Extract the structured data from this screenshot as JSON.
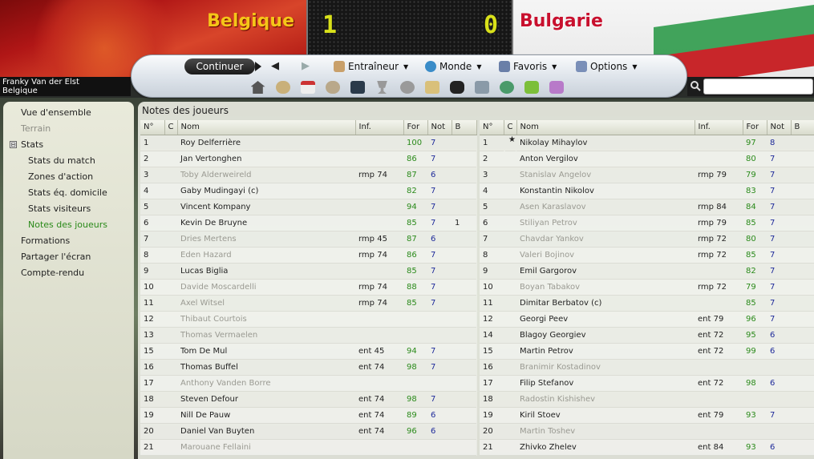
{
  "header": {
    "home_team": "Belgique",
    "away_team": "Bulgarie",
    "home_score": "1",
    "away_score": "0",
    "home_color": "#f5c518",
    "away_color": "#c8102e"
  },
  "toolbar": {
    "continue_label": "Continuer",
    "back_icon": "arrow-left-icon",
    "forward_icon": "arrow-right-icon",
    "menus": [
      {
        "label": "Entraîneur",
        "icon": "manager-icon"
      },
      {
        "label": "Monde",
        "icon": "globe-icon"
      },
      {
        "label": "Favoris",
        "icon": "favorites-icon"
      },
      {
        "label": "Options",
        "icon": "options-icon"
      }
    ],
    "icons": [
      "home-icon",
      "club-icon",
      "calendar-icon",
      "squad-icon",
      "tactics-icon",
      "trophy-icon",
      "scout-icon",
      "clipboard-icon",
      "binoculars-icon",
      "inbox-icon",
      "world-icon",
      "help-icon",
      "question-icon"
    ]
  },
  "manager": {
    "name": "Franky Van der Elst",
    "team": "Belgique"
  },
  "sidebar": {
    "items": [
      {
        "label": "Vue d'ensemble",
        "level": 1,
        "state": "normal"
      },
      {
        "label": "Terrain",
        "level": 1,
        "state": "disabled"
      },
      {
        "label": "Stats",
        "level": 1,
        "state": "normal",
        "toggle": "⊟"
      },
      {
        "label": "Stats du match",
        "level": 2,
        "state": "normal"
      },
      {
        "label": "Zones d'action",
        "level": 2,
        "state": "normal"
      },
      {
        "label": "Stats éq. domicile",
        "level": 2,
        "state": "normal"
      },
      {
        "label": "Stats visiteurs",
        "level": 2,
        "state": "normal"
      },
      {
        "label": "Notes des joueurs",
        "level": 2,
        "state": "active"
      },
      {
        "label": "Formations",
        "level": 1,
        "state": "normal"
      },
      {
        "label": "Partager l'écran",
        "level": 1,
        "state": "normal"
      },
      {
        "label": "Compte-rendu",
        "level": 1,
        "state": "normal"
      }
    ]
  },
  "panel": {
    "title": "Notes des joueurs",
    "columns": [
      "N°",
      "C",
      "Nom",
      "Inf.",
      "For",
      "Not",
      "B"
    ]
  },
  "home_players": [
    {
      "num": "1",
      "c": "",
      "name": "Roy Delferrière",
      "inf": "",
      "for": "100",
      "note": "7",
      "b": "",
      "played": true
    },
    {
      "num": "2",
      "c": "",
      "name": "Jan Vertonghen",
      "inf": "",
      "for": "86",
      "note": "7",
      "b": "",
      "played": true
    },
    {
      "num": "3",
      "c": "",
      "name": "Toby Alderweireld",
      "inf": "rmp 74",
      "for": "87",
      "note": "6",
      "b": "",
      "played": false
    },
    {
      "num": "4",
      "c": "",
      "name": "Gaby Mudingayi (c)",
      "inf": "",
      "for": "82",
      "note": "7",
      "b": "",
      "played": true
    },
    {
      "num": "5",
      "c": "",
      "name": "Vincent Kompany",
      "inf": "",
      "for": "94",
      "note": "7",
      "b": "",
      "played": true
    },
    {
      "num": "6",
      "c": "",
      "name": "Kevin De Bruyne",
      "inf": "",
      "for": "85",
      "note": "7",
      "b": "1",
      "played": true
    },
    {
      "num": "7",
      "c": "",
      "name": "Dries Mertens",
      "inf": "rmp 45",
      "for": "87",
      "note": "6",
      "b": "",
      "played": false
    },
    {
      "num": "8",
      "c": "",
      "name": "Eden Hazard",
      "inf": "rmp 74",
      "for": "86",
      "note": "7",
      "b": "",
      "played": false
    },
    {
      "num": "9",
      "c": "",
      "name": "Lucas Biglia",
      "inf": "",
      "for": "85",
      "note": "7",
      "b": "",
      "played": true
    },
    {
      "num": "10",
      "c": "",
      "name": "Davide Moscardelli",
      "inf": "rmp 74",
      "for": "88",
      "note": "7",
      "b": "",
      "played": false
    },
    {
      "num": "11",
      "c": "",
      "name": "Axel Witsel",
      "inf": "rmp 74",
      "for": "85",
      "note": "7",
      "b": "",
      "played": false
    },
    {
      "num": "12",
      "c": "",
      "name": "Thibaut Courtois",
      "inf": "",
      "for": "",
      "note": "",
      "b": "",
      "played": false
    },
    {
      "num": "13",
      "c": "",
      "name": "Thomas Vermaelen",
      "inf": "",
      "for": "",
      "note": "",
      "b": "",
      "played": false
    },
    {
      "num": "15",
      "c": "",
      "name": "Tom De Mul",
      "inf": "ent 45",
      "for": "94",
      "note": "7",
      "b": "",
      "played": true
    },
    {
      "num": "16",
      "c": "",
      "name": "Thomas Buffel",
      "inf": "ent 74",
      "for": "98",
      "note": "7",
      "b": "",
      "played": true
    },
    {
      "num": "17",
      "c": "",
      "name": "Anthony Vanden Borre",
      "inf": "",
      "for": "",
      "note": "",
      "b": "",
      "played": false
    },
    {
      "num": "18",
      "c": "",
      "name": "Steven Defour",
      "inf": "ent 74",
      "for": "98",
      "note": "7",
      "b": "",
      "played": true
    },
    {
      "num": "19",
      "c": "",
      "name": "Nill De Pauw",
      "inf": "ent 74",
      "for": "89",
      "note": "6",
      "b": "",
      "played": true
    },
    {
      "num": "20",
      "c": "",
      "name": "Daniel Van Buyten",
      "inf": "ent 74",
      "for": "96",
      "note": "6",
      "b": "",
      "played": true
    },
    {
      "num": "21",
      "c": "",
      "name": "Marouane Fellaini",
      "inf": "",
      "for": "",
      "note": "",
      "b": "",
      "played": false
    }
  ],
  "away_players": [
    {
      "num": "1",
      "c": "★",
      "name": "Nikolay Mihaylov",
      "inf": "",
      "for": "97",
      "note": "8",
      "b": "",
      "played": true
    },
    {
      "num": "2",
      "c": "",
      "name": "Anton Vergilov",
      "inf": "",
      "for": "80",
      "note": "7",
      "b": "",
      "played": true
    },
    {
      "num": "3",
      "c": "",
      "name": "Stanislav Angelov",
      "inf": "rmp 79",
      "for": "79",
      "note": "7",
      "b": "",
      "played": false
    },
    {
      "num": "4",
      "c": "",
      "name": "Konstantin Nikolov",
      "inf": "",
      "for": "83",
      "note": "7",
      "b": "",
      "played": true
    },
    {
      "num": "5",
      "c": "",
      "name": "Asen Karaslavov",
      "inf": "rmp 84",
      "for": "84",
      "note": "7",
      "b": "",
      "played": false
    },
    {
      "num": "6",
      "c": "",
      "name": "Stiliyan Petrov",
      "inf": "rmp 79",
      "for": "85",
      "note": "7",
      "b": "",
      "played": false
    },
    {
      "num": "7",
      "c": "",
      "name": "Chavdar Yankov",
      "inf": "rmp 72",
      "for": "80",
      "note": "7",
      "b": "",
      "played": false
    },
    {
      "num": "8",
      "c": "",
      "name": "Valeri Bojinov",
      "inf": "rmp 72",
      "for": "85",
      "note": "7",
      "b": "",
      "played": false
    },
    {
      "num": "9",
      "c": "",
      "name": "Emil Gargorov",
      "inf": "",
      "for": "82",
      "note": "7",
      "b": "",
      "played": true
    },
    {
      "num": "10",
      "c": "",
      "name": "Boyan Tabakov",
      "inf": "rmp 72",
      "for": "79",
      "note": "7",
      "b": "",
      "played": false
    },
    {
      "num": "11",
      "c": "",
      "name": "Dimitar Berbatov (c)",
      "inf": "",
      "for": "85",
      "note": "7",
      "b": "",
      "played": true
    },
    {
      "num": "12",
      "c": "",
      "name": "Georgi Peev",
      "inf": "ent 79",
      "for": "96",
      "note": "7",
      "b": "",
      "played": true
    },
    {
      "num": "14",
      "c": "",
      "name": "Blagoy Georgiev",
      "inf": "ent 72",
      "for": "95",
      "note": "6",
      "b": "",
      "played": true
    },
    {
      "num": "15",
      "c": "",
      "name": "Martin Petrov",
      "inf": "ent 72",
      "for": "99",
      "note": "6",
      "b": "",
      "played": true
    },
    {
      "num": "16",
      "c": "",
      "name": "Branimir Kostadinov",
      "inf": "",
      "for": "",
      "note": "",
      "b": "",
      "played": false
    },
    {
      "num": "17",
      "c": "",
      "name": "Filip Stefanov",
      "inf": "ent 72",
      "for": "98",
      "note": "6",
      "b": "",
      "played": true
    },
    {
      "num": "18",
      "c": "",
      "name": "Radostin Kishishev",
      "inf": "",
      "for": "",
      "note": "",
      "b": "",
      "played": false
    },
    {
      "num": "19",
      "c": "",
      "name": "Kiril Stoev",
      "inf": "ent 79",
      "for": "93",
      "note": "7",
      "b": "",
      "played": true
    },
    {
      "num": "20",
      "c": "",
      "name": "Martin Toshev",
      "inf": "",
      "for": "",
      "note": "",
      "b": "",
      "played": false
    },
    {
      "num": "21",
      "c": "",
      "name": "Zhivko Zhelev",
      "inf": "ent 84",
      "for": "93",
      "note": "6",
      "b": "",
      "played": true
    }
  ]
}
